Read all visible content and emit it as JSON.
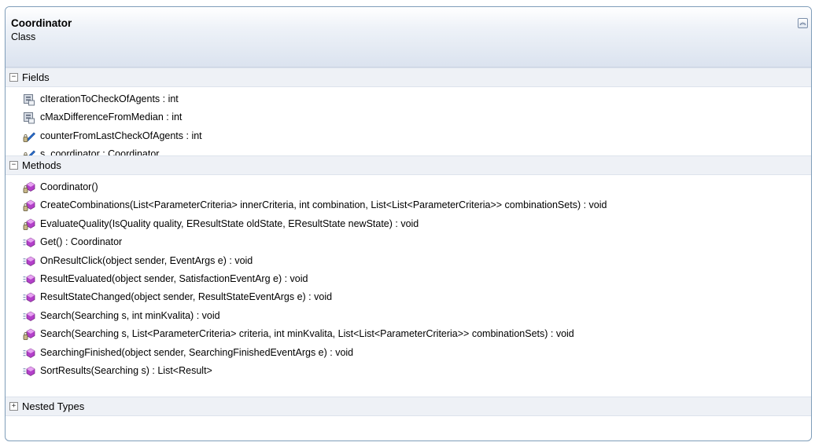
{
  "class": {
    "name": "Coordinator",
    "stereotype": "Class",
    "collapse_icon": "double-chevron-up-icon"
  },
  "sections": {
    "fields": {
      "label": "Fields",
      "toggle": "−",
      "items": [
        {
          "text": "cIterationToCheckOfAgents : int",
          "icon": "const-field-icon"
        },
        {
          "text": "cMaxDifferenceFromMedian : int",
          "icon": "const-field-icon"
        },
        {
          "text": "counterFromLastCheckOfAgents : int",
          "icon": "private-field-icon"
        },
        {
          "text": "s_coordinator : Coordinator",
          "icon": "private-static-field-icon"
        }
      ]
    },
    "methods": {
      "label": "Methods",
      "toggle": "−",
      "items": [
        {
          "text": "Coordinator()",
          "icon": "private-method-icon"
        },
        {
          "text": "CreateCombinations(List<ParameterCriteria> innerCriteria, int combination, List<List<ParameterCriteria>> combinationSets) : void",
          "icon": "private-method-icon"
        },
        {
          "text": "EvaluateQuality(IsQuality quality, EResultState oldState, EResultState newState) : void",
          "icon": "private-method-icon"
        },
        {
          "text": "Get() : Coordinator",
          "icon": "public-method-icon"
        },
        {
          "text": "OnResultClick(object sender, EventArgs e) : void",
          "icon": "public-method-icon"
        },
        {
          "text": "ResultEvaluated(object sender, SatisfactionEventArg e) : void",
          "icon": "public-method-icon"
        },
        {
          "text": "ResultStateChanged(object sender, ResultStateEventArgs e) : void",
          "icon": "public-method-icon"
        },
        {
          "text": "Search(Searching s, int minKvalita) : void",
          "icon": "public-method-icon"
        },
        {
          "text": "Search(Searching s, List<ParameterCriteria> criteria, int minKvalita, List<List<ParameterCriteria>> combinationSets) : void",
          "icon": "private-method-icon"
        },
        {
          "text": "SearchingFinished(object sender, SearchingFinishedEventArgs e) : void",
          "icon": "public-method-icon"
        },
        {
          "text": "SortResults(Searching s) : List<Result>",
          "icon": "public-method-icon"
        }
      ]
    },
    "nested_types": {
      "label": "Nested Types",
      "toggle": "+"
    }
  }
}
